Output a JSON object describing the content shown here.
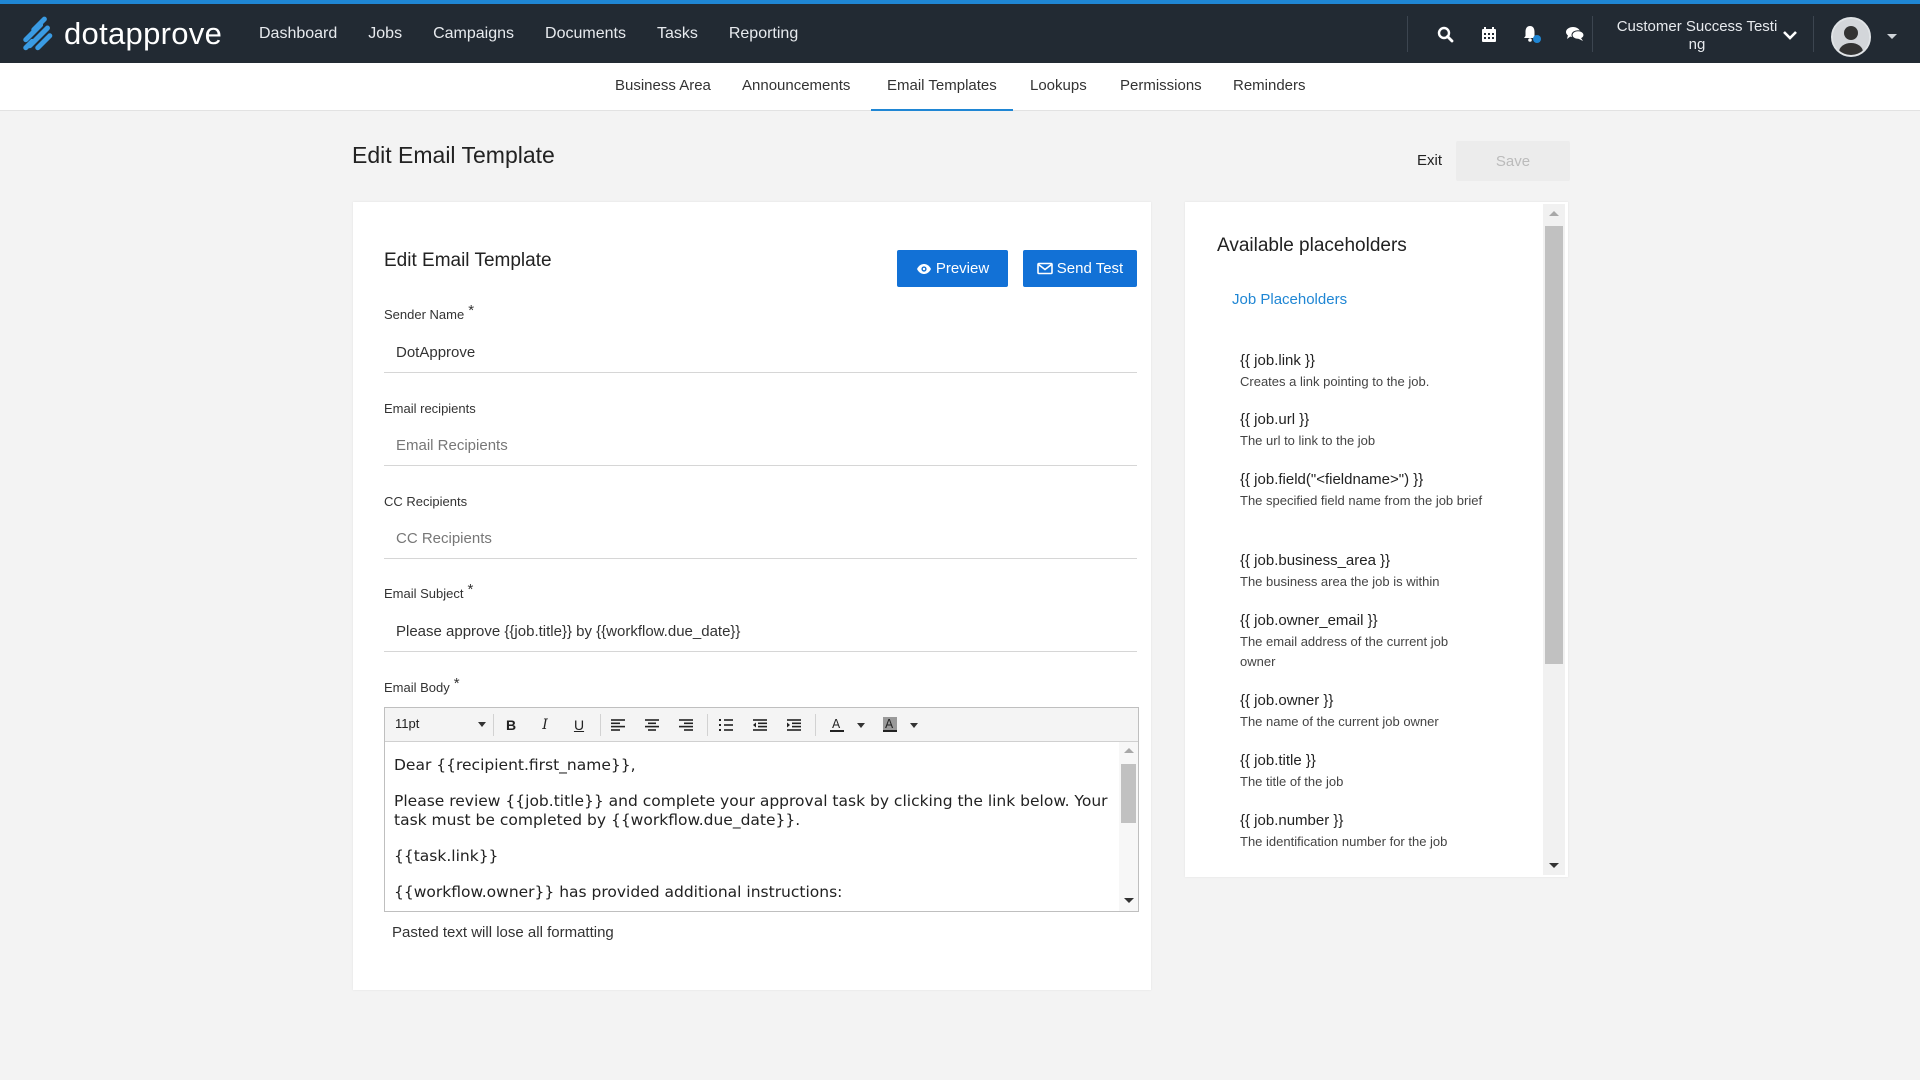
{
  "app": {
    "logo_text": "dotapprove"
  },
  "nav": {
    "items": [
      "Dashboard",
      "Jobs",
      "Campaigns",
      "Documents",
      "Tasks",
      "Reporting"
    ]
  },
  "user": {
    "name": "Customer Success Testi ng"
  },
  "subnav": {
    "tabs": [
      "Business Area",
      "Announcements",
      "Email Templates",
      "Lookups",
      "Permissions",
      "Reminders"
    ],
    "active": "Email Templates"
  },
  "page": {
    "title": "Edit Email Template",
    "exit_label": "Exit",
    "save_label": "Save"
  },
  "form": {
    "title": "Edit Email Template",
    "preview_label": "Preview",
    "send_test_label": "Send Test",
    "sender_name": {
      "label": "Sender Name",
      "required": "*",
      "value": "DotApprove"
    },
    "email_recipients": {
      "label": "Email recipients",
      "placeholder": "Email Recipients"
    },
    "cc_recipients": {
      "label": "CC Recipients",
      "placeholder": "CC Recipients"
    },
    "email_subject": {
      "label": "Email Subject",
      "required": "*",
      "value": "Please approve {{job.title}} by {{workflow.due_date}}"
    },
    "email_body": {
      "label": "Email Body",
      "required": "*",
      "font_size": "11pt",
      "paragraphs": [
        "Dear {{recipient.first_name}},",
        "Please review {{job.title}} and complete your approval task by clicking the link below. Your task must be completed by {{workflow.due_date}}.",
        "{{task.link}}",
        "{{workflow.owner}} has provided additional instructions:"
      ]
    },
    "hint": "Pasted text will lose all formatting"
  },
  "placeholders": {
    "title": "Available placeholders",
    "section_link": "Job Placeholders",
    "items": [
      {
        "code": "{{ job.link }}",
        "desc": "Creates a link pointing to the job."
      },
      {
        "code": "{{ job.url }}",
        "desc": "The url to link to the job"
      },
      {
        "code": "{{ job.field(\"<fieldname>\") }}",
        "desc": "The specified field name from the job brief"
      },
      {
        "code": "{{ job.business_area }}",
        "desc": "The business area the job is within"
      },
      {
        "code": "{{ job.owner_email }}",
        "desc": "The email address of the current job owner"
      },
      {
        "code": "{{ job.owner }}",
        "desc": "The name of the current job owner"
      },
      {
        "code": "{{ job.title }}",
        "desc": "The title of the job"
      },
      {
        "code": "{{ job.number }}",
        "desc": "The identification number for the job"
      }
    ]
  },
  "colors": {
    "accent": "#1f86d4",
    "button": "#1271d6",
    "topbar": "#222a33"
  }
}
